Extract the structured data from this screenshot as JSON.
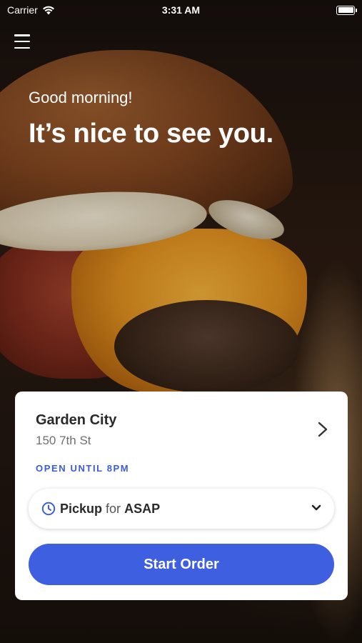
{
  "status_bar": {
    "carrier": "Carrier",
    "time": "3:31 AM"
  },
  "header": {
    "menu_icon": "hamburger-menu-icon"
  },
  "hero": {
    "greeting": "Good morning!",
    "headline": "It’s nice to see you."
  },
  "location_card": {
    "name": "Garden City",
    "address": "150 7th St",
    "hours": "OPEN UNTIL 8PM",
    "pickup": {
      "mode": "Pickup",
      "connector": "for",
      "time": "ASAP"
    },
    "start_order_label": "Start Order"
  },
  "colors": {
    "accent": "#3d5fe0",
    "hours_text": "#3b5bdb"
  }
}
